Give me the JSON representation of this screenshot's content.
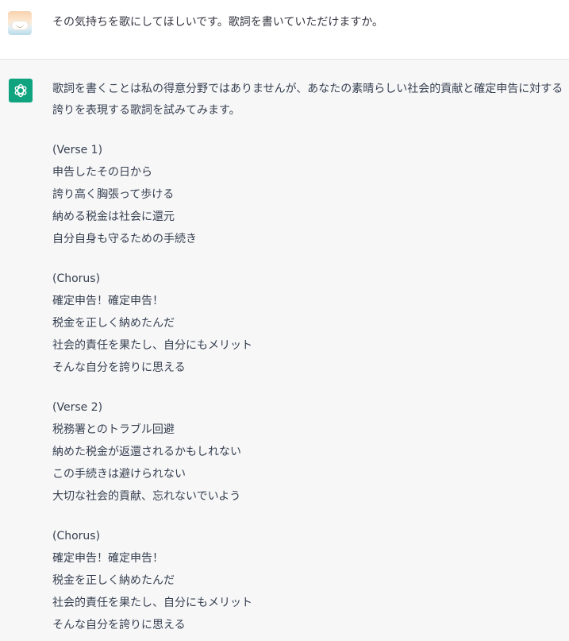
{
  "user_message": {
    "text": "その気持ちを歌にしてほしいです。歌詞を書いていただけますか。",
    "avatar_icon": "user-avatar-icon"
  },
  "assistant_message": {
    "avatar_icon": "openai-logo-icon",
    "avatar_color": "#10a37f",
    "intro_lines": [
      "歌詞を書くことは私の得意分野ではありませんが、あなたの素晴らしい社会的貢献と確定申告に対する",
      "誇りを表現する歌詞を試みてみます。"
    ],
    "stanzas": [
      {
        "lines": [
          "(Verse 1)",
          "申告したその日から",
          "誇り高く胸張って歩ける",
          "納める税金は社会に還元",
          "自分自身も守るための手続き"
        ]
      },
      {
        "lines": [
          "(Chorus)",
          "確定申告！確定申告！",
          "税金を正しく納めたんだ",
          "社会的責任を果たし、自分にもメリット",
          "そんな自分を誇りに思える"
        ]
      },
      {
        "lines": [
          "(Verse 2)",
          "税務署とのトラブル回避",
          "納めた税金が返還されるかもしれない",
          "この手続きは避けられない",
          "大切な社会的貢献、忘れないでいよう"
        ]
      },
      {
        "lines": [
          "(Chorus)",
          "確定申告！確定申告！",
          "税金を正しく納めたんだ",
          "社会的責任を果たし、自分にもメリット",
          "そんな自分を誇りに思える"
        ]
      }
    ]
  }
}
